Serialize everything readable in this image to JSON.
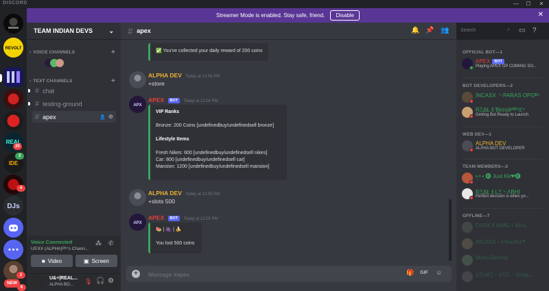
{
  "window": {
    "brand": "DISCORD"
  },
  "banner": {
    "text": "Streamer Mode is enabled. Stay safe, friend.",
    "button": "Disable"
  },
  "guild_badges": {
    "g9": "20",
    "g10": "3",
    "g11": "4",
    "g17": "2",
    "g18": "6",
    "new": "NEW"
  },
  "server": {
    "name": "TEAM INDIAN DEVS"
  },
  "categories": {
    "voice": "VOICE CHANNELS",
    "text": "TEXT CHANNELS"
  },
  "channels": [
    "chat",
    "testing-ground",
    "apex"
  ],
  "voice": {
    "status": "Voice Connected",
    "channel": "U𝔼ⅩX (ALPHA)ᴰᴱᵛ's Chann...",
    "video": "Video",
    "screen": "Screen"
  },
  "user": {
    "name": "U&≡|REAL...",
    "tag": "ALPHA BO..."
  },
  "chat": {
    "channel": "apex",
    "search_placeholder": "Search",
    "composer_placeholder": "Message #apex",
    "daily_reward": "✅ You've collected your daily reward of 200 coins",
    "messages": [
      {
        "author": "ALPHA DEV",
        "time": "Today at 12:04 PM",
        "text": "+store"
      },
      {
        "author": "APEX",
        "bot": "BOT",
        "time": "Today at 12:04 PM",
        "embed": [
          "VIP Ranks",
          "",
          "Bronze: 200 Coins [undefinedbuy/undefinedsell bronze]",
          "",
          "Lifestyle Items",
          "",
          "Fresh Nikes: 600 [undefinedbuy/undefinedsell nikes]",
          "Car: 800 [undefinedbuy/undefinedsell car]",
          "Mansion: 1200 [undefinedbuy/undefinedsell mansion]"
        ]
      },
      {
        "author": "ALPHA DEV",
        "time": "Today at 12:05 PM",
        "text": "+slots 500"
      },
      {
        "author": "APEX",
        "bot": "BOT",
        "time": "Today at 12:05 PM",
        "embed": [
          "🍉 | 🍇 | 🍌",
          "",
          "You lost 500 coins"
        ]
      }
    ]
  },
  "members": {
    "groups": [
      {
        "label": "OFFICIAL BOT—1"
      },
      {
        "label": "BOT DEVELOPERS—2"
      },
      {
        "label": "WEB DEV—1"
      },
      {
        "label": "TEAM MEMBERS—2"
      },
      {
        "label": "OFFLINE—7"
      }
    ],
    "list": [
      {
        "name": "APEX",
        "bot": "BOT",
        "sub": "Playing APEX OP COMING SO...",
        "color": "#e83d3d",
        "status": "#3ba55d"
      },
      {
        "name": "INCASX 丶PARAS OP𝔻ᴱᵛ",
        "sub": "",
        "color": "#3ba55d",
        "status": "#ed4245"
      },
      {
        "name": "RΞΔŁ ‖ Ɓℓσσ∂ʸᴰᴱᵛ𝔼ᵛ",
        "sub": "Getting Bot Ready to Launch",
        "color": "#3ba55d",
        "status": "#ed4245"
      },
      {
        "name": "ALPHA DEV",
        "sub": "ALPHA BOT DEVELOPER",
        "color": "#f0b232",
        "status": "#ed4245"
      },
      {
        "name": "•͙✧•͙ 🅚 Just Kk❤🅔",
        "sub": "",
        "color": "#3ba55d",
        "status": "#ed4245"
      },
      {
        "name": "RΞΔŁ ‖ LΞ丶ΛBHI",
        "sub": "Perfect decision is when yo...",
        "color": "#3ba55d",
        "status": "#ed4245"
      },
      {
        "name": "DΛRK ‖ AiMG・Mira...",
        "sub": "",
        "color": "#3ba55d",
        "status": "#747f8d"
      },
      {
        "name": "INCASX・Pikachuᴰᴱ",
        "sub": "",
        "color": "#3ba55d",
        "status": "#747f8d"
      },
      {
        "name": "MsKsTanmay",
        "sub": "",
        "color": "#3ba55d",
        "status": "#747f8d"
      },
      {
        "name": "UΞxXΞ・VΞG・Uniqu...",
        "sub": "",
        "color": "#3ba55d",
        "status": "#747f8d"
      }
    ]
  }
}
